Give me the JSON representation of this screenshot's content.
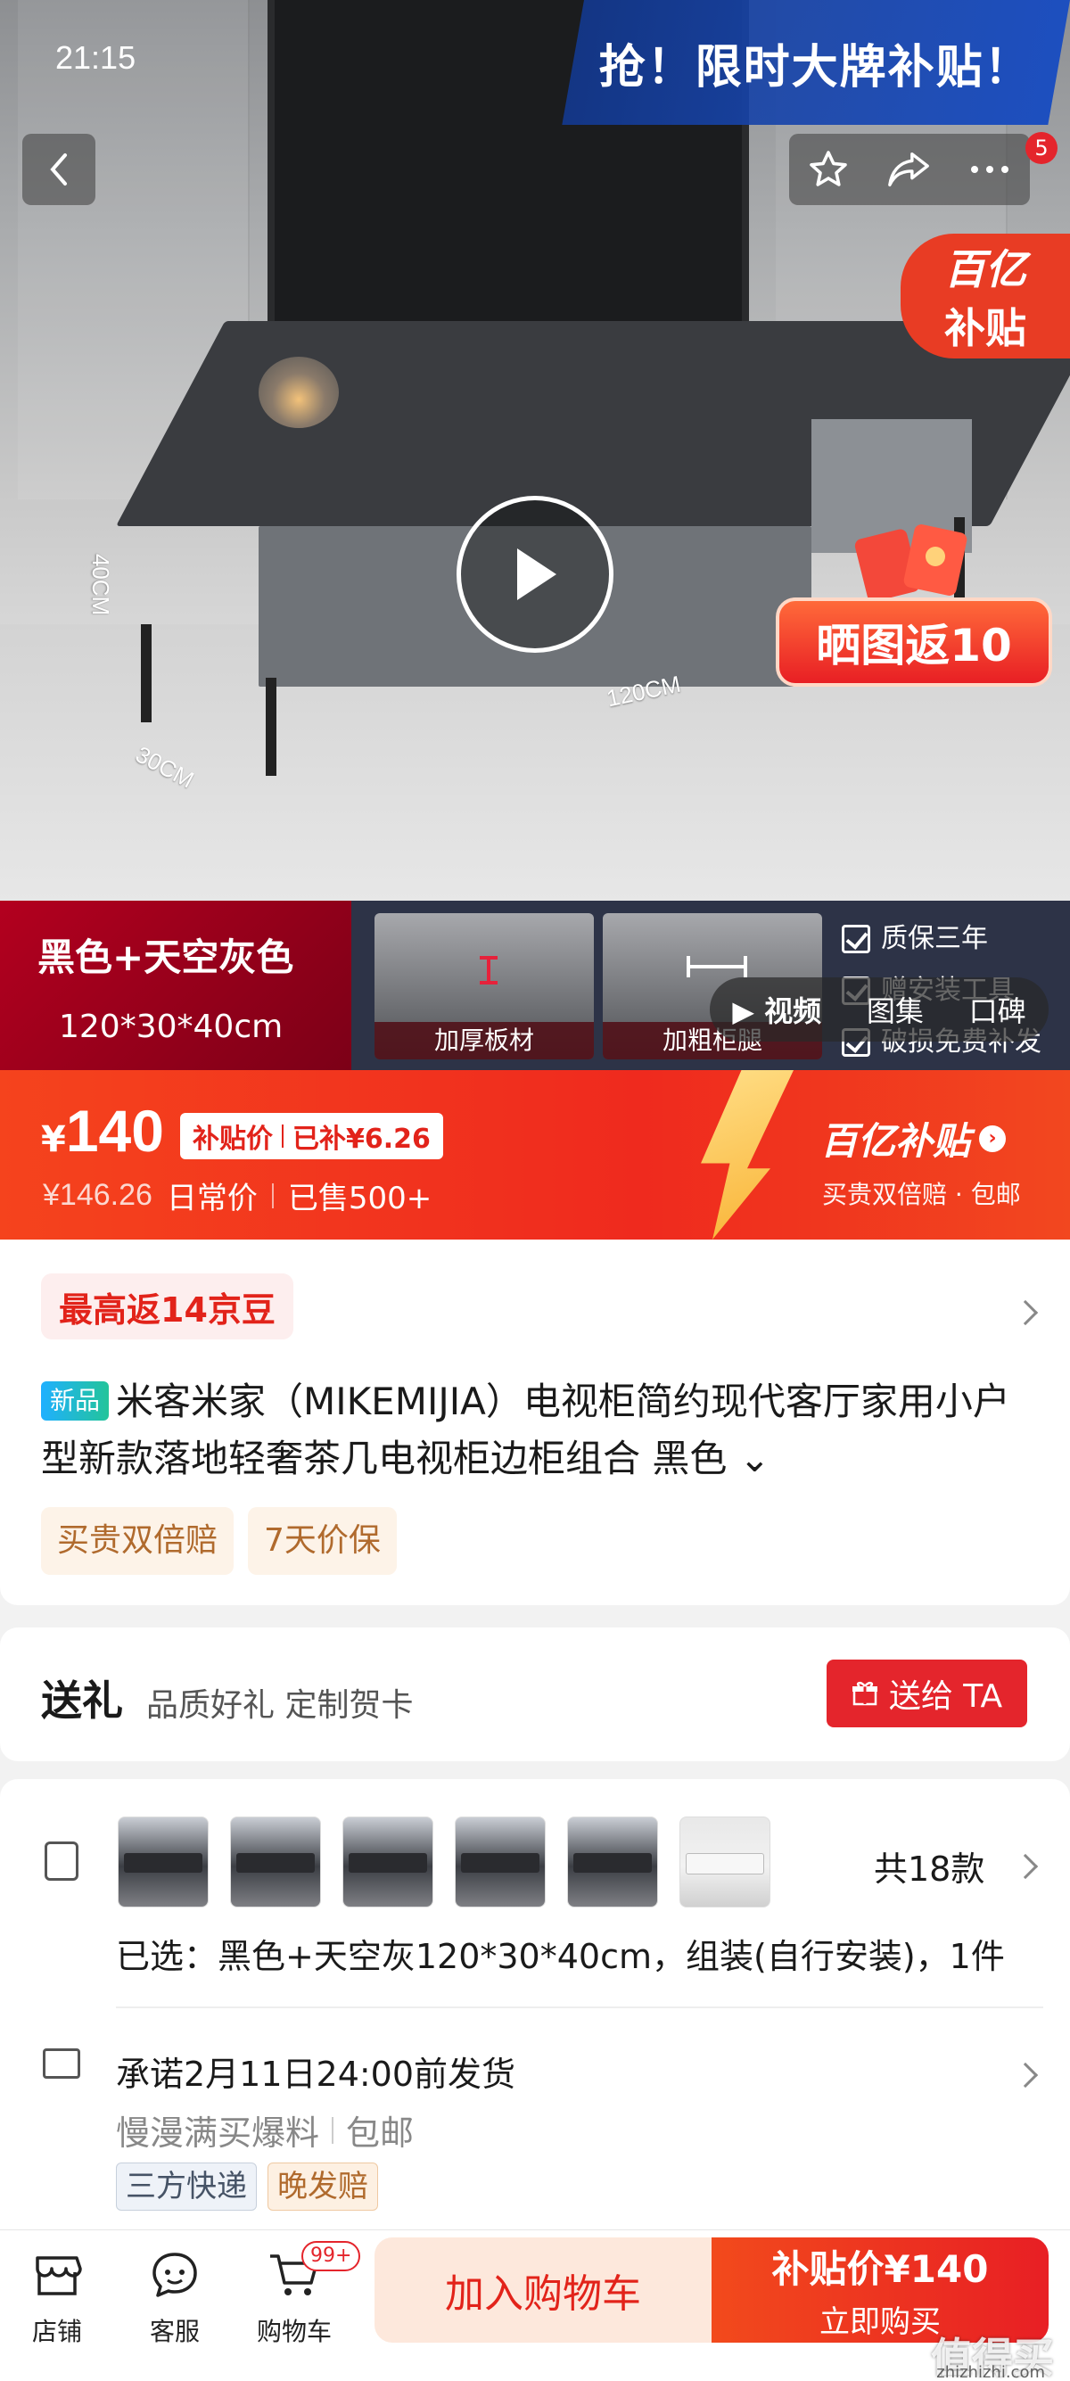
{
  "status_bar": {
    "time": "21:15"
  },
  "hero": {
    "promo_banner": "抢！限时大牌补贴！",
    "top_actions_badge": "5",
    "subsidy_corner": {
      "line1": "百亿",
      "line2": "补贴"
    },
    "photo_return": "晒图返10",
    "dimensions": {
      "height": "40CM",
      "length": "120CM",
      "depth": "30CM"
    }
  },
  "info_strip": {
    "color_name": "黑色+天空灰色",
    "size": "120*30*40cm",
    "thumbs": [
      "加厚板材",
      "加粗柜腿"
    ],
    "guarantees": [
      "质保三年",
      "赠安装工具",
      "破损免费补发"
    ],
    "media_tabs": [
      "视频",
      "图集",
      "口碑"
    ]
  },
  "price": {
    "currency": "¥",
    "amount": "140",
    "subsidy_label": "补贴价",
    "subsidy_amount": "已补¥6.26",
    "original": "¥146.26",
    "original_label": "日常价",
    "sold": "已售500+",
    "brand": "百亿补贴",
    "brand_sub": "买贵双倍赔 · 包邮"
  },
  "product": {
    "beans": "最高返14京豆",
    "new_tag": "新品",
    "title": "米客米家（MIKEMIJIA）电视柜简约现代客厅家用小户型新款落地轻奢茶几电视柜边柜组合 黑色",
    "tags": [
      "买贵双倍赔",
      "7天价保"
    ]
  },
  "gift": {
    "title": "送礼",
    "desc": "品质好礼 定制贺卡",
    "button": "送给 TA"
  },
  "spec": {
    "count": "共18款",
    "selected": "已选：黑色+天空灰120*30*40cm，组装(自行安装)，1件"
  },
  "shipping": {
    "promise": "承诺2月11日24:00前发货",
    "store": "慢漫满买爆料",
    "free": "包邮",
    "tags": [
      "三方快递",
      "晚发赔"
    ]
  },
  "bottom_bar": {
    "items": [
      "店铺",
      "客服",
      "购物车"
    ],
    "cart_badge": "99+",
    "add_cart": "加入购物车",
    "buy_price": "补贴价¥140",
    "buy_label": "立即购买"
  },
  "watermark": {
    "main": "值得买",
    "sub": "zhizhizhi.com"
  }
}
